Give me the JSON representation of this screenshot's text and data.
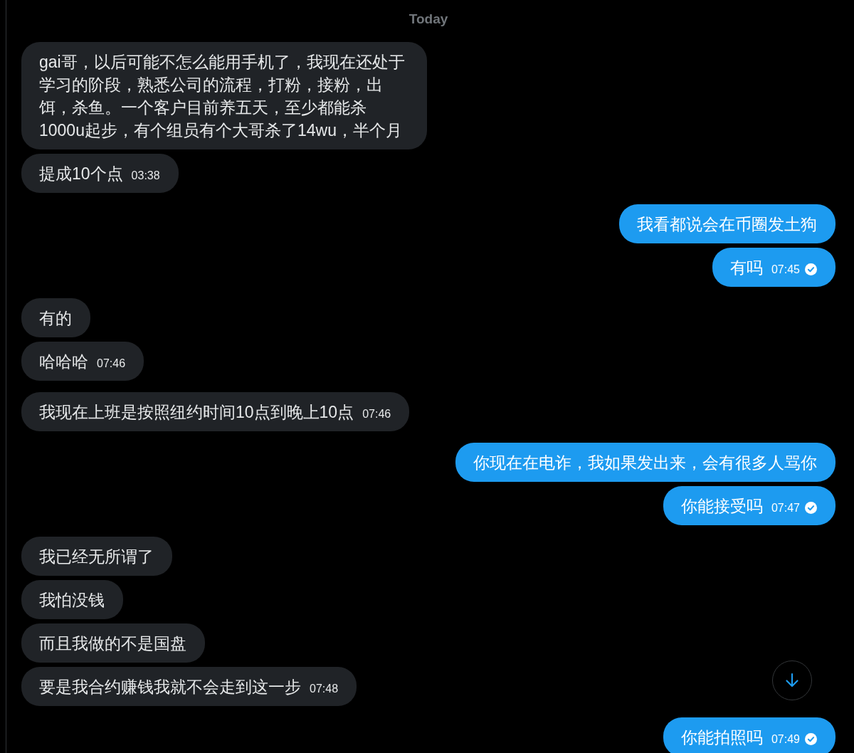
{
  "date_divider": {
    "label": "Today"
  },
  "messages": [
    {
      "kind": "received",
      "bubbles": [
        {
          "text": "gai哥，以后可能不怎么能用手机了，我现在还处于学习的阶段，熟悉公司的流程，打粉，接粉，出饵，杀鱼。一个客户目前养五天，至少都能杀1000u起步，有个组员有个大哥杀了14wu，半个月",
          "read": false
        },
        {
          "text": "提成10个点",
          "time": "03:38",
          "read": false
        }
      ]
    },
    {
      "kind": "sent",
      "bubbles": [
        {
          "text": "我看都说会在币圈发土狗",
          "read": false
        },
        {
          "text": "有吗",
          "time": "07:45",
          "read": true
        }
      ]
    },
    {
      "kind": "received",
      "bubbles": [
        {
          "text": "有的",
          "read": false
        },
        {
          "text": "哈哈哈",
          "time": "07:46",
          "read": false
        }
      ]
    },
    {
      "kind": "received",
      "bubbles": [
        {
          "text": "我现在上班是按照纽约时间10点到晚上10点",
          "time": "07:46",
          "read": false
        }
      ]
    },
    {
      "kind": "sent",
      "bubbles": [
        {
          "text": "你现在在电诈，我如果发出来，会有很多人骂你",
          "read": false
        },
        {
          "text": "你能接受吗",
          "time": "07:47",
          "read": true
        }
      ]
    },
    {
      "kind": "received",
      "bubbles": [
        {
          "text": "我已经无所谓了",
          "read": false
        },
        {
          "text": "我怕没钱",
          "read": false
        },
        {
          "text": "而且我做的不是国盘",
          "read": false
        },
        {
          "text": "要是我合约赚钱我就不会走到这一步",
          "time": "07:48",
          "read": false
        }
      ]
    },
    {
      "kind": "sent",
      "bubbles": [
        {
          "text": "你能拍照吗",
          "time": "07:49",
          "read": true
        }
      ]
    }
  ]
}
